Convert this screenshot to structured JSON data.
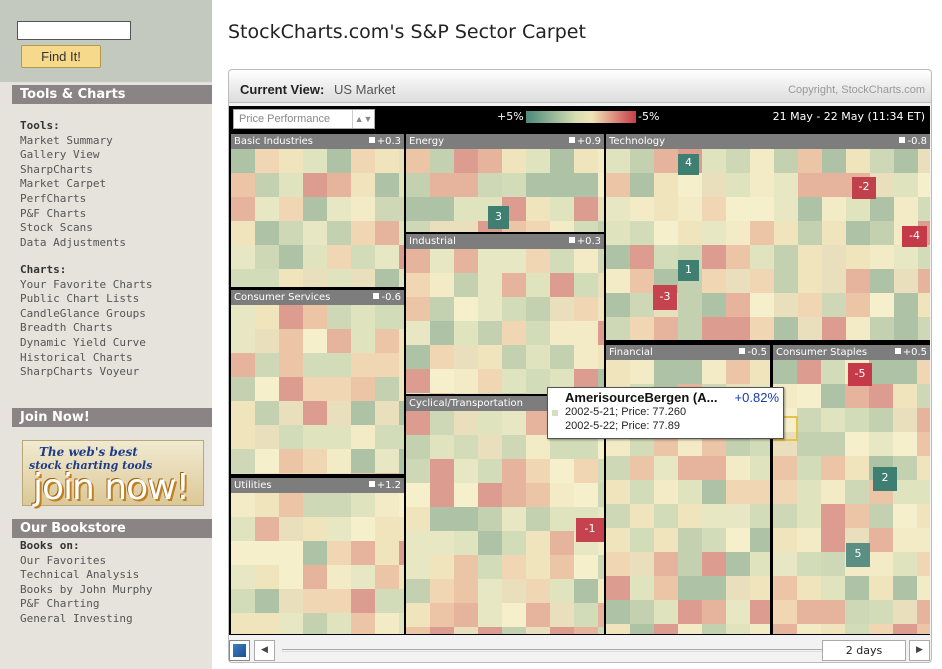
{
  "sidebar": {
    "find_button": "Find It!",
    "tools_header": "Tools & Charts",
    "tools_heading": "Tools:",
    "tools_items": [
      "Market Summary",
      "Gallery View",
      "SharpCharts",
      "Market Carpet",
      "PerfCharts",
      "P&F Charts",
      "Stock Scans",
      "Data Adjustments"
    ],
    "charts_heading": "Charts:",
    "charts_items": [
      "Your Favorite Charts",
      "Public Chart Lists",
      "CandleGlance Groups",
      "Breadth Charts",
      "Dynamic Yield Curve",
      "Historical Charts",
      "SharpCharts Voyeur"
    ],
    "join_header": "Join Now!",
    "join_ad": {
      "line1": "The web's best",
      "line2": "stock charting tools",
      "line3": "join now!"
    },
    "bookstore_header": "Our Bookstore",
    "books_heading": "Books on:",
    "books_items": [
      "Our Favorites",
      "Technical Analysis",
      "Books by John Murphy",
      "P&F Charting",
      "General Investing"
    ]
  },
  "page": {
    "title": "StockCharts.com's S&P Sector Carpet"
  },
  "panel": {
    "current_view_label": "Current View:",
    "current_view_value": "US Market",
    "copyright": "Copyright, StockCharts.com",
    "metric": "Price Performance",
    "legend_pos": "+5%",
    "legend_neg": "-5%",
    "date_range": "21 May - 22 May (11:34 ET)",
    "days": "2 days"
  },
  "sectors": [
    {
      "name": "Basic Industries",
      "change": "+0.3"
    },
    {
      "name": "Energy",
      "change": "+0.9"
    },
    {
      "name": "Technology",
      "change": "-0.8"
    },
    {
      "name": "Industrial",
      "change": "+0.3"
    },
    {
      "name": "Consumer Services",
      "change": "-0.6"
    },
    {
      "name": "Financial",
      "change": "-0.5"
    },
    {
      "name": "Consumer Staples",
      "change": "+0.5"
    },
    {
      "name": "Cyclical/Transportation",
      "change": ""
    },
    {
      "name": "Utilities",
      "change": "+1.2"
    }
  ],
  "ranks": [
    "4",
    "-2",
    "-4",
    "1",
    "-3",
    "3",
    "-5",
    "2",
    "5",
    "-1"
  ],
  "tooltip": {
    "name": "AmerisourceBergen (A...",
    "change": "+0.82%",
    "line1": "2002-5-21; Price: 77.260",
    "line2": "2002-5-22; Price: 77.89"
  }
}
